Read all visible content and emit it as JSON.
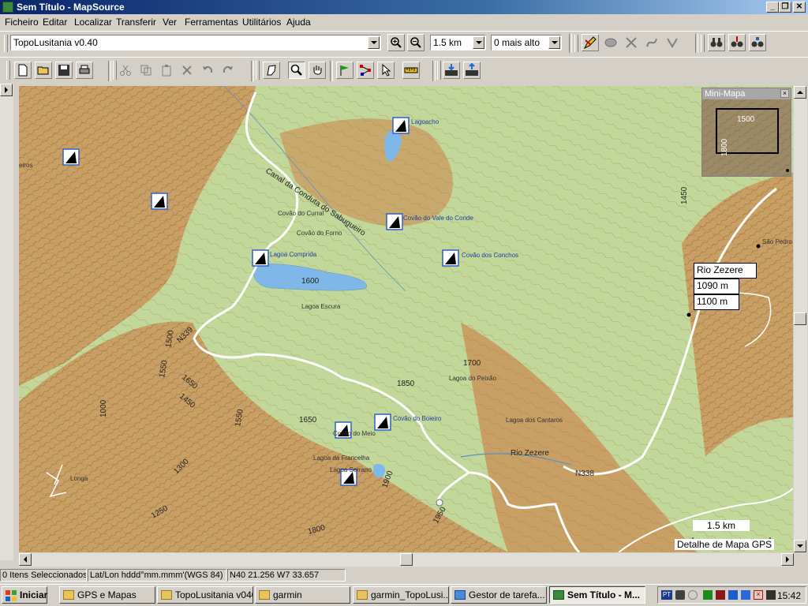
{
  "window": {
    "title": "Sem Título - MapSource",
    "minimize_glyph": "_",
    "maximize_glyph": "❐",
    "close_glyph": "✕"
  },
  "menu": [
    "Ficheiro",
    "Editar",
    "Localizar",
    "Transferir",
    "Ver",
    "Ferramentas",
    "Utilitários",
    "Ajuda"
  ],
  "toolbar": {
    "map_product": "TopoLusitania v0.40",
    "zoom_scale": "1.5 km",
    "detail_level": "0 mais alto"
  },
  "map": {
    "colors": {
      "terrain_green": "#c1d89a",
      "terrain_brown": "#c9955a",
      "contour": "#a36b3a",
      "water": "#7fb8e8",
      "road": "#ffffff"
    },
    "place_labels": {
      "lagoacho": "Lagoacho",
      "covao_curral": "Covão do Curral",
      "covao_forno": "Covão do Forno",
      "lagoa_comprida": "Lagoa Comprida",
      "covao_vale_conde": "Covão do Vale do Conde",
      "covao_conchos": "Covão dos Conchos",
      "lagoa_escura": "Lagoa Escura",
      "lagoa_peixao": "Lagoa do Peixão",
      "covao_boieiro": "Covão do Boieiro",
      "covao_meio": "Covão do Meio",
      "lagoa_cantaros": "Lagoa dos Cantaros",
      "lagoa_francelha": "Lagoa da Francelha",
      "lagoa_serrano": "Lagoa Serrano",
      "longa": "Longa",
      "sao_pedro": "São Pedro",
      "cut_left": "eiros",
      "canal": "Canal da Conduta do Sabugueiro",
      "rio_zezere": "Rio Zezere"
    },
    "elevation_labels": [
      "1600",
      "1700",
      "1850",
      "1650",
      "1500",
      "1550",
      "1650",
      "1450",
      "1000",
      "1550",
      "1300",
      "1250",
      "1900",
      "1950",
      "1800",
      "1450"
    ],
    "road_labels": {
      "n339": "N339",
      "n338": "N338"
    },
    "tooltip": {
      "name": "Rio Zezere",
      "elevation_1": "1090 m",
      "elevation_2": "1100 m"
    },
    "scale_bar": "1.5 km",
    "detail_caption": "Detalhe de Mapa GPS"
  },
  "minimap": {
    "title": "Mini-Mapa",
    "label_1": "1500",
    "label_2": "1800"
  },
  "statusbar": {
    "selected": "0 Itens Seleccionados",
    "format": "Lat/Lon hddd°mm.mmm'(WGS 84)",
    "position": "N40 21.256 W7 33.657"
  },
  "taskbar": {
    "start": "Iniciar",
    "tasks": [
      "GPS e Mapas",
      "TopoLusitania v040",
      "garmin",
      "garmin_TopoLusi...",
      "Gestor de tarefa...",
      "Sem Título - M..."
    ],
    "clock": "15:42",
    "tray_text": "PT"
  }
}
